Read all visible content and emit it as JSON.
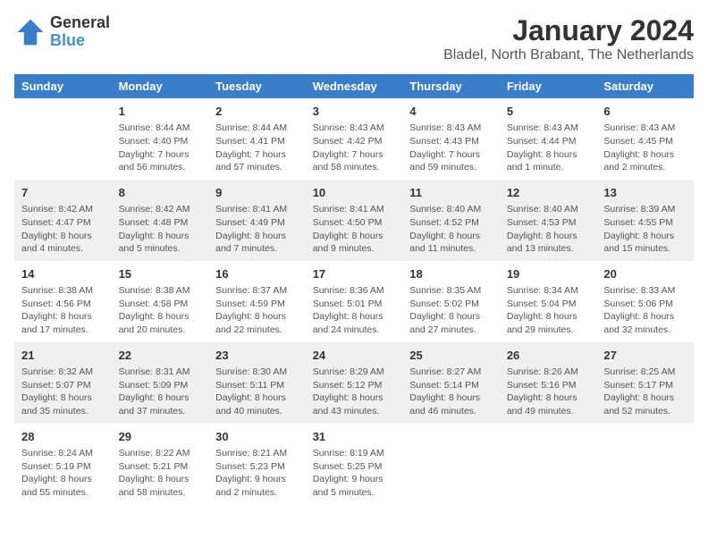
{
  "header": {
    "logo": {
      "line1": "General",
      "line2": "Blue"
    },
    "title": "January 2024",
    "subtitle": "Bladel, North Brabant, The Netherlands"
  },
  "columns": [
    "Sunday",
    "Monday",
    "Tuesday",
    "Wednesday",
    "Thursday",
    "Friday",
    "Saturday"
  ],
  "weeks": [
    [
      {
        "day": "",
        "info": ""
      },
      {
        "day": "1",
        "info": "Sunrise: 8:44 AM\nSunset: 4:40 PM\nDaylight: 7 hours\nand 56 minutes."
      },
      {
        "day": "2",
        "info": "Sunrise: 8:44 AM\nSunset: 4:41 PM\nDaylight: 7 hours\nand 57 minutes."
      },
      {
        "day": "3",
        "info": "Sunrise: 8:43 AM\nSunset: 4:42 PM\nDaylight: 7 hours\nand 58 minutes."
      },
      {
        "day": "4",
        "info": "Sunrise: 8:43 AM\nSunset: 4:43 PM\nDaylight: 7 hours\nand 59 minutes."
      },
      {
        "day": "5",
        "info": "Sunrise: 8:43 AM\nSunset: 4:44 PM\nDaylight: 8 hours\nand 1 minute."
      },
      {
        "day": "6",
        "info": "Sunrise: 8:43 AM\nSunset: 4:45 PM\nDaylight: 8 hours\nand 2 minutes."
      }
    ],
    [
      {
        "day": "7",
        "info": "Sunrise: 8:42 AM\nSunset: 4:47 PM\nDaylight: 8 hours\nand 4 minutes."
      },
      {
        "day": "8",
        "info": "Sunrise: 8:42 AM\nSunset: 4:48 PM\nDaylight: 8 hours\nand 5 minutes."
      },
      {
        "day": "9",
        "info": "Sunrise: 8:41 AM\nSunset: 4:49 PM\nDaylight: 8 hours\nand 7 minutes."
      },
      {
        "day": "10",
        "info": "Sunrise: 8:41 AM\nSunset: 4:50 PM\nDaylight: 8 hours\nand 9 minutes."
      },
      {
        "day": "11",
        "info": "Sunrise: 8:40 AM\nSunset: 4:52 PM\nDaylight: 8 hours\nand 11 minutes."
      },
      {
        "day": "12",
        "info": "Sunrise: 8:40 AM\nSunset: 4:53 PM\nDaylight: 8 hours\nand 13 minutes."
      },
      {
        "day": "13",
        "info": "Sunrise: 8:39 AM\nSunset: 4:55 PM\nDaylight: 8 hours\nand 15 minutes."
      }
    ],
    [
      {
        "day": "14",
        "info": "Sunrise: 8:38 AM\nSunset: 4:56 PM\nDaylight: 8 hours\nand 17 minutes."
      },
      {
        "day": "15",
        "info": "Sunrise: 8:38 AM\nSunset: 4:58 PM\nDaylight: 8 hours\nand 20 minutes."
      },
      {
        "day": "16",
        "info": "Sunrise: 8:37 AM\nSunset: 4:59 PM\nDaylight: 8 hours\nand 22 minutes."
      },
      {
        "day": "17",
        "info": "Sunrise: 8:36 AM\nSunset: 5:01 PM\nDaylight: 8 hours\nand 24 minutes."
      },
      {
        "day": "18",
        "info": "Sunrise: 8:35 AM\nSunset: 5:02 PM\nDaylight: 8 hours\nand 27 minutes."
      },
      {
        "day": "19",
        "info": "Sunrise: 8:34 AM\nSunset: 5:04 PM\nDaylight: 8 hours\nand 29 minutes."
      },
      {
        "day": "20",
        "info": "Sunrise: 8:33 AM\nSunset: 5:06 PM\nDaylight: 8 hours\nand 32 minutes."
      }
    ],
    [
      {
        "day": "21",
        "info": "Sunrise: 8:32 AM\nSunset: 5:07 PM\nDaylight: 8 hours\nand 35 minutes."
      },
      {
        "day": "22",
        "info": "Sunrise: 8:31 AM\nSunset: 5:09 PM\nDaylight: 8 hours\nand 37 minutes."
      },
      {
        "day": "23",
        "info": "Sunrise: 8:30 AM\nSunset: 5:11 PM\nDaylight: 8 hours\nand 40 minutes."
      },
      {
        "day": "24",
        "info": "Sunrise: 8:29 AM\nSunset: 5:12 PM\nDaylight: 8 hours\nand 43 minutes."
      },
      {
        "day": "25",
        "info": "Sunrise: 8:27 AM\nSunset: 5:14 PM\nDaylight: 8 hours\nand 46 minutes."
      },
      {
        "day": "26",
        "info": "Sunrise: 8:26 AM\nSunset: 5:16 PM\nDaylight: 8 hours\nand 49 minutes."
      },
      {
        "day": "27",
        "info": "Sunrise: 8:25 AM\nSunset: 5:17 PM\nDaylight: 8 hours\nand 52 minutes."
      }
    ],
    [
      {
        "day": "28",
        "info": "Sunrise: 8:24 AM\nSunset: 5:19 PM\nDaylight: 8 hours\nand 55 minutes."
      },
      {
        "day": "29",
        "info": "Sunrise: 8:22 AM\nSunset: 5:21 PM\nDaylight: 8 hours\nand 58 minutes."
      },
      {
        "day": "30",
        "info": "Sunrise: 8:21 AM\nSunset: 5:23 PM\nDaylight: 9 hours\nand 2 minutes."
      },
      {
        "day": "31",
        "info": "Sunrise: 8:19 AM\nSunset: 5:25 PM\nDaylight: 9 hours\nand 5 minutes."
      },
      {
        "day": "",
        "info": ""
      },
      {
        "day": "",
        "info": ""
      },
      {
        "day": "",
        "info": ""
      }
    ]
  ]
}
